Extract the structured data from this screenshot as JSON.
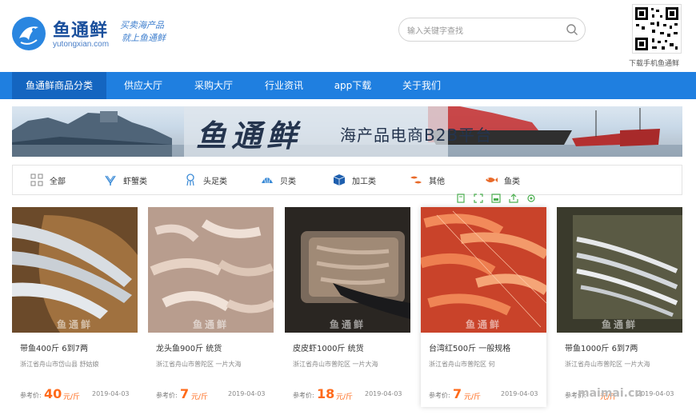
{
  "header": {
    "logo_text": "鱼通鲜",
    "logo_sub": "yutongxian.com",
    "slogan_line1": "买卖海产品",
    "slogan_line2": "就上鱼通鲜",
    "search_placeholder": "输入关键字查找",
    "qr_caption": "下载手机鱼通鲜"
  },
  "nav": {
    "items": [
      "鱼通鲜商品分类",
      "供应大厅",
      "采购大厅",
      "行业资讯",
      "app下载",
      "关于我们"
    ],
    "active_color": "#1465c0",
    "bar_color": "#1f7fe0"
  },
  "banner": {
    "title": "鱼通鲜",
    "subtitle": "海产品电商B2B平台"
  },
  "categories": [
    {
      "label": "全部",
      "icon": "grid-icon"
    },
    {
      "label": "虾蟹类",
      "icon": "shrimp-icon"
    },
    {
      "label": "头足类",
      "icon": "squid-icon"
    },
    {
      "label": "贝类",
      "icon": "shell-icon"
    },
    {
      "label": "加工类",
      "icon": "box-icon"
    },
    {
      "label": "其他",
      "icon": "fish-mix-icon"
    },
    {
      "label": "鱼类",
      "icon": "fish-icon"
    }
  ],
  "products": [
    {
      "title": "带鱼400斤 6到7两",
      "location": "浙江省舟山市岱山县 舒姑娘",
      "price_label": "参考价:",
      "price": "40",
      "unit": "元/斤",
      "date": "2019-04-03",
      "watermark": "鱼通鲜"
    },
    {
      "title": "龙头鱼900斤 统货",
      "location": "浙江省舟山市普陀区 一片大海",
      "price_label": "参考价:",
      "price": "7",
      "unit": "元/斤",
      "date": "2019-04-03",
      "watermark": "鱼通鲜"
    },
    {
      "title": "皮皮虾1000斤 统货",
      "location": "浙江省舟山市普陀区 一片大海",
      "price_label": "参考价:",
      "price": "18",
      "unit": "元/斤",
      "date": "2019-04-03",
      "watermark": "鱼通鲜"
    },
    {
      "title": "台湾红500斤 一般规格",
      "location": "浙江省舟山市普陀区 何",
      "price_label": "参考价:",
      "price": "7",
      "unit": "元/斤",
      "date": "2019-04-03",
      "watermark": "鱼通鲜"
    },
    {
      "title": "带鱼1000斤 6到7两",
      "location": "浙江省舟山市普陀区 一片大海",
      "price_label": "参考价:",
      "price": "",
      "unit": "元/斤",
      "date": "2019-04-03",
      "watermark": "鱼通鲜"
    }
  ],
  "footer_watermark": "maimai.cn",
  "colors": {
    "price": "#ff6a1a",
    "brand": "#1a4f9c"
  }
}
